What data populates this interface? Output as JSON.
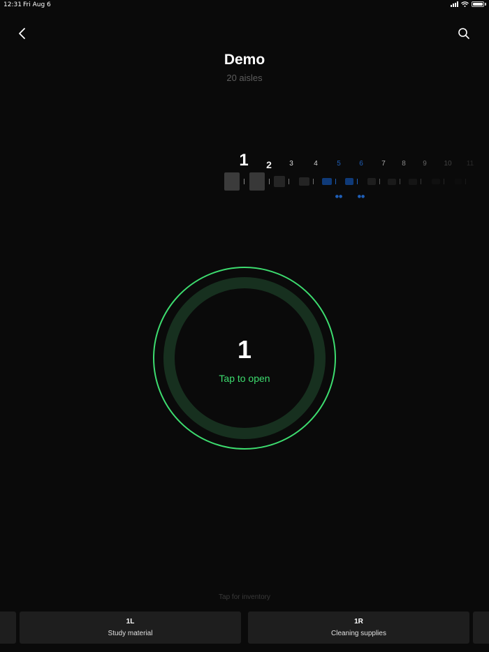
{
  "status_bar": {
    "time": "12:31",
    "date": "Fri Aug 6"
  },
  "nav": {
    "back_icon": "chevron-left-icon",
    "search_icon": "search-icon"
  },
  "header": {
    "title": "Demo",
    "subtitle": "20 aisles"
  },
  "aisles": {
    "labels": [
      "1",
      "2",
      "3",
      "4",
      "5",
      "6",
      "7",
      "8",
      "9",
      "10",
      "11"
    ],
    "selected": "1",
    "highlighted": [
      "5",
      "6"
    ],
    "highlight_color": "#1f5fb8"
  },
  "ring": {
    "number": "1",
    "label": "Tap to open",
    "accent_color": "#3ddc6f"
  },
  "inventory": {
    "hint": "Tap for inventory",
    "cards": [
      {
        "code": "1L",
        "name": "Study material"
      },
      {
        "code": "1R",
        "name": "Cleaning supplies"
      }
    ]
  }
}
